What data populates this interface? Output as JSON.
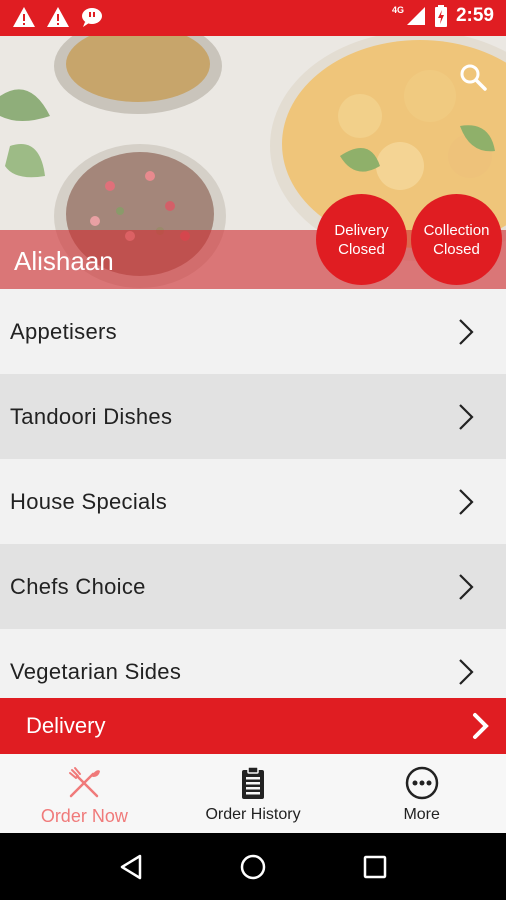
{
  "status_bar": {
    "time": "2:59",
    "network": "4G",
    "left_icons": [
      "warning-icon",
      "warning-icon",
      "message-icon"
    ],
    "right_icons": [
      "signal-icon",
      "battery-icon"
    ]
  },
  "hero": {
    "restaurant_name": "Alishaan",
    "delivery_status": "Delivery\nClosed",
    "collection_status": "Collection\nClosed",
    "search_icon": "search-icon"
  },
  "categories": [
    {
      "label": "Appetisers"
    },
    {
      "label": "Tandoori Dishes"
    },
    {
      "label": "House Specials"
    },
    {
      "label": "Chefs Choice"
    },
    {
      "label": "Vegetarian Sides"
    }
  ],
  "delivery_bar": {
    "label": "Delivery"
  },
  "tabs": [
    {
      "label": "Order Now",
      "icon": "fork-knife-icon",
      "active": true
    },
    {
      "label": "Order History",
      "icon": "clipboard-icon",
      "active": false
    },
    {
      "label": "More",
      "icon": "more-icon",
      "active": false
    }
  ],
  "colors": {
    "brand_red": "#e01d22",
    "active_tab": "#f07a7a"
  }
}
